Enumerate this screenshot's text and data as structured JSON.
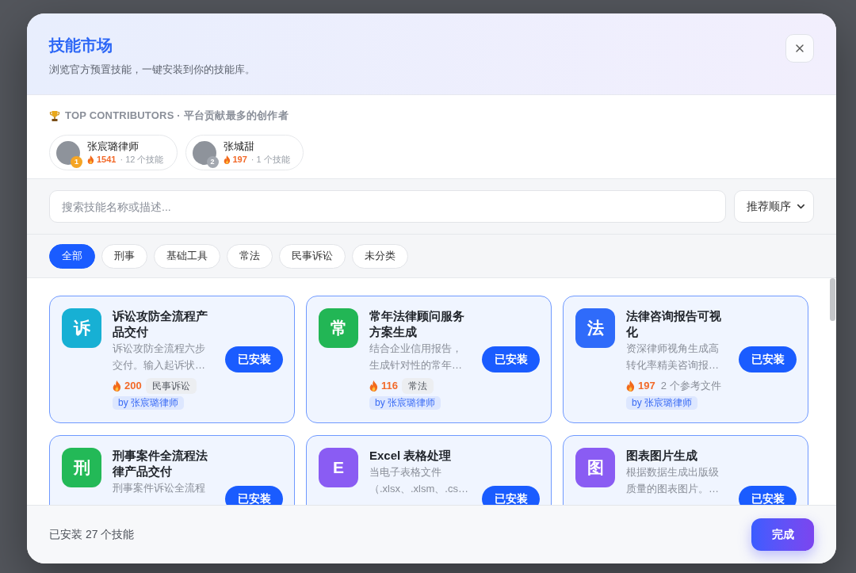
{
  "dialog": {
    "title": "技能市场",
    "subtitle": "浏览官方预置技能，一键安装到你的技能库。"
  },
  "contributors": {
    "heading": "TOP CONTRIBUTORS · 平台贡献最多的创作者",
    "items": [
      {
        "name": "张宸璐律师",
        "rank": "1",
        "color": "#f5a524",
        "score": "1541",
        "skills": "· 12 个技能"
      },
      {
        "name": "张城甜",
        "rank": "2",
        "color": "#a3a8b0",
        "score": "197",
        "skills": "· 1 个技能"
      }
    ]
  },
  "search": {
    "placeholder": "搜索技能名称或描述...",
    "sort": "推荐顺序"
  },
  "filters": [
    {
      "label": "全部",
      "selected": true
    },
    {
      "label": "刑事",
      "selected": false
    },
    {
      "label": "基础工具",
      "selected": false
    },
    {
      "label": "常法",
      "selected": false
    },
    {
      "label": "民事诉讼",
      "selected": false
    },
    {
      "label": "未分类",
      "selected": false
    }
  ],
  "skills": [
    {
      "icon_text": "诉",
      "color": "#17b0d4",
      "title": "诉讼攻防全流程产品交付",
      "description": "诉讼攻防全流程六步交付。输入起诉状…",
      "score": "200",
      "meta": {
        "kind": "tag",
        "text": "民事诉讼"
      },
      "author": "by 张宸璐律师",
      "button": {
        "label": "已安装",
        "installed": true
      }
    },
    {
      "icon_text": "常",
      "color": "#22b655",
      "title": "常年法律顾问服务方案生成",
      "description": "结合企业信用报告，生成针对性的常年…",
      "score": "116",
      "meta": {
        "kind": "tag",
        "text": "常法"
      },
      "author": "by 张宸璐律师",
      "button": {
        "label": "已安装",
        "installed": true
      }
    },
    {
      "icon_text": "法",
      "color": "#2f6bfa",
      "title": "法律咨询报告可视化",
      "description": "资深律师视角生成高转化率精美咨询报…",
      "score": "197",
      "meta": {
        "kind": "files",
        "text": "2 个参考文件"
      },
      "author": "by 张宸璐律师",
      "button": {
        "label": "已安装",
        "installed": true
      }
    },
    {
      "icon_text": "刑",
      "color": "#23b957",
      "title": "刑事案件全流程法律产品交付",
      "description": "刑事案件诉讼全流程",
      "button": {
        "label": "已安装",
        "installed": true
      }
    },
    {
      "icon_text": "E",
      "color": "#8a5cf3",
      "title": "Excel 表格处理",
      "description": "当电子表格文件（.xlsx、.xlsm、.cs…",
      "button": {
        "label": "已安装",
        "installed": true
      }
    },
    {
      "icon_text": "图",
      "color": "#8a5cf3",
      "title": "图表图片生成",
      "description": "根据数据生成出版级质量的图表图片。…",
      "button": {
        "label": "已安装",
        "installed": true
      }
    }
  ],
  "footer": {
    "summary": "已安装 27 个技能",
    "done_button": "完成"
  }
}
